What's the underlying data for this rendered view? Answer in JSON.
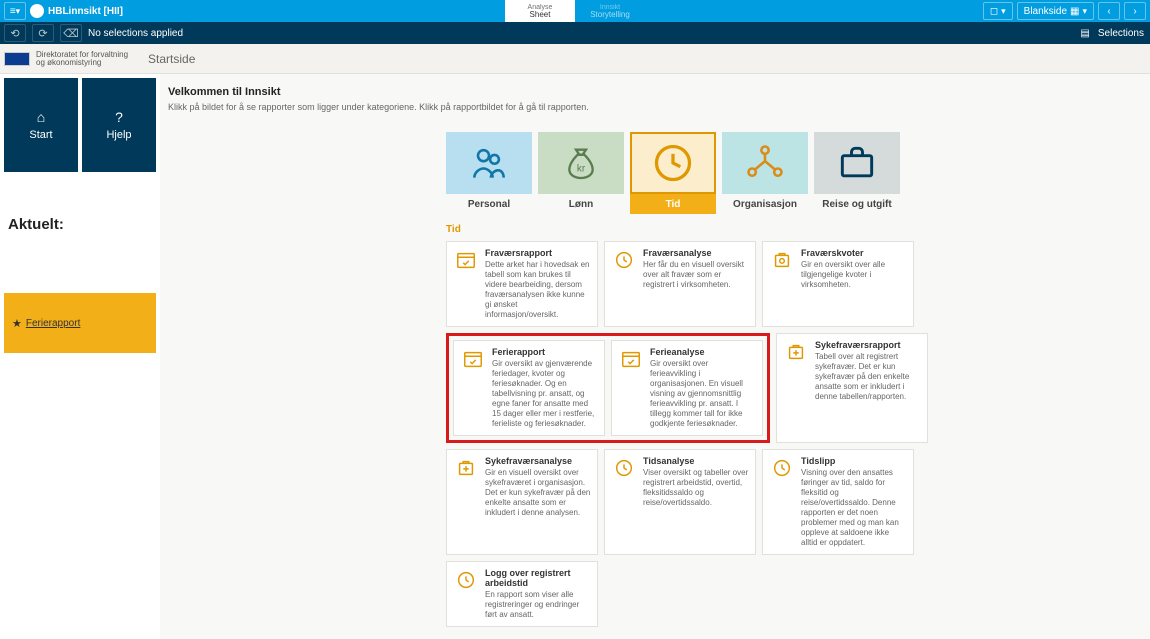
{
  "topbar": {
    "app_title": "HBLinnsikt [HII]",
    "tab_analyse_sub": "Analyse",
    "tab_analyse": "Sheet",
    "tab_insight_sub": "Innsikt",
    "tab_insight": "Storytelling",
    "right_btn1": "Blankside",
    "bookmark_icon": "bookmark"
  },
  "selbar": {
    "no_sel": "No selections applied",
    "selections": "Selections"
  },
  "header": {
    "org1": "Direktoratet for forvaltning",
    "org2": "og økonomistyring",
    "page": "Startside"
  },
  "nav": {
    "start": "Start",
    "hjelp": "Hjelp"
  },
  "aktuelt": {
    "heading": "Aktuelt:",
    "link": "Ferierapport"
  },
  "welcome": {
    "title": "Velkommen til Innsikt",
    "sub": "Klikk på bildet for å se rapporter som ligger under kategoriene. Klikk på rapportbildet for å gå til rapporten."
  },
  "categories": {
    "personal": "Personal",
    "lonn": "Lønn",
    "tid": "Tid",
    "org": "Organisasjon",
    "reise": "Reise og utgift"
  },
  "section": {
    "tid": "Tid"
  },
  "cards": {
    "fravaersrapport": {
      "title": "Fraværsrapport",
      "desc": "Dette arket har i hovedsak en tabell som kan brukes til videre bearbeiding, dersom fraværsanalysen ikke kunne gi ønsket informasjon/oversikt."
    },
    "fravaersanalyse": {
      "title": "Fraværsanalyse",
      "desc": "Her får du en visuell oversikt over alt fravær som er registrert i virksomheten."
    },
    "fravaerskvoter": {
      "title": "Fraværskvoter",
      "desc": "Gir en oversikt over alle tilgjengelige kvoter i virksomheten."
    },
    "ferierapport": {
      "title": "Ferierapport",
      "desc": "Gir oversikt av gjenværende feriedager, kvoter og feriesøknader. Og en tabellvisning pr. ansatt, og egne faner for ansatte med 15 dager eller mer i restferie, ferieliste og feriesøknader."
    },
    "ferieanalyse": {
      "title": "Ferieanalyse",
      "desc": "Gir oversikt over ferieavvikling i organisasjonen. En visuell visning av gjennomsnittlig ferieavvikling pr. ansatt. I tillegg kommer tall for ikke godkjente feriesøknader."
    },
    "sykefravaersrapport": {
      "title": "Sykefraværsrapport",
      "desc": "Tabell over alt registrert sykefravær. Det er kun sykefravær på den enkelte ansatte som er inkludert i denne tabellen/rapporten."
    },
    "sykefravaersanalyse": {
      "title": "Sykefraværsanalyse",
      "desc": "Gir en visuell oversikt over sykefraværet i organisasjon. Det er kun sykefravær på den enkelte ansatte som er inkludert i denne analysen."
    },
    "tidsanalyse": {
      "title": "Tidsanalyse",
      "desc": "Viser oversikt og tabeller over registrert arbeidstid, overtid, fleksitidssaldo og reise/overtidssaldo."
    },
    "tidslipp": {
      "title": "Tidslipp",
      "desc": "Visning over den ansattes føringer av tid, saldo for fleksitid og reise/overtidssaldo. Denne rapporten er det noen problemer med og man kan oppleve at saldoene ikke alltid er oppdatert."
    },
    "logg": {
      "title": "Logg over registrert arbeidstid",
      "desc": "En rapport som viser alle registreringer og endringer ført av ansatt."
    }
  }
}
